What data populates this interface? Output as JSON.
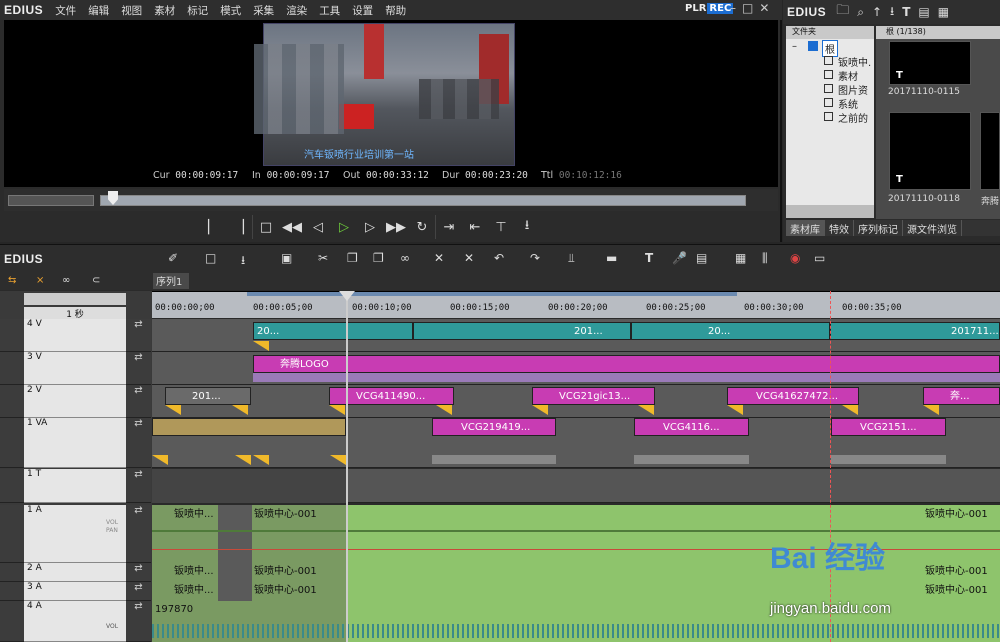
{
  "player": {
    "app_name": "EDIUS",
    "menu": [
      "文件",
      "编辑",
      "视图",
      "素材",
      "标记",
      "模式",
      "采集",
      "渲染",
      "工具",
      "设置",
      "帮助"
    ],
    "plr": "PLR",
    "rec": "REC",
    "window_buttons": "–□✕",
    "subtitle": "汽车钣喷行业培训第一站",
    "timecodes": {
      "cur_label": "Cur",
      "cur": "00:00:09:17",
      "in_label": "In",
      "in": "00:00:09:17",
      "out_label": "Out",
      "out": "00:00:33:12",
      "dur_label": "Dur",
      "dur": "00:00:23:20",
      "ttl_label": "Ttl",
      "ttl": "00:10:12:16"
    }
  },
  "bin": {
    "app_name": "EDIUS",
    "folder_header": "文件夹",
    "folders": [
      "根",
      "钣喷中.",
      "素材",
      "图片资",
      "系统",
      "之前的"
    ],
    "clip_header": "根 (1/138)",
    "clips": [
      "20171110-0115",
      "20171110-0118",
      "奔腾"
    ],
    "tabs": [
      "素材库",
      "特效",
      "序列标记",
      "源文件浏览"
    ]
  },
  "timeline": {
    "app_name": "EDIUS",
    "sequence_tab": "序列1",
    "scale": "1 秒",
    "ruler": [
      "00:00:00;00",
      "00:00:05;00",
      "00:00:10;00",
      "00:00:15;00",
      "00:00:20;00",
      "00:00:25;00",
      "00:00:30;00",
      "00:00:35;00"
    ],
    "tracks": [
      {
        "name": "4 V"
      },
      {
        "name": "3 V"
      },
      {
        "name": "2 V"
      },
      {
        "name": "1 VA"
      },
      {
        "name": "1 T"
      },
      {
        "name": "1 A"
      },
      {
        "name": "2 A"
      },
      {
        "name": "3 A"
      },
      {
        "name": "4 A"
      }
    ],
    "clips": {
      "v4a": "20...",
      "v4b": "201...",
      "v4c": "20...",
      "v4d": "201711...",
      "v3": "奔腾LOGO",
      "v2a": "201...",
      "v2b": "VCG411490...",
      "v2c": "VCG21gic13...",
      "v2d": "VCG41627472...",
      "v2e": "奔...",
      "v1a": "VCG219419...",
      "v1b": "VCG4116...",
      "v1c": "VCG2151...",
      "a1a": "钣喷中...",
      "a1b": "钣喷中心-001",
      "a1c": "钣喷中心-001",
      "a2a": "钣喷中...",
      "a2b": "钣喷中心-001",
      "a2c": "钣喷中心-001",
      "a3a": "钣喷中...",
      "a3b": "钣喷中心-001",
      "a3c": "钣喷中心-001",
      "a4": "197870"
    },
    "vol_label": "VOL",
    "pan_label": "PAN"
  },
  "watermark": {
    "brand": "Bai  经验",
    "url": "jingyan.baidu.com"
  }
}
